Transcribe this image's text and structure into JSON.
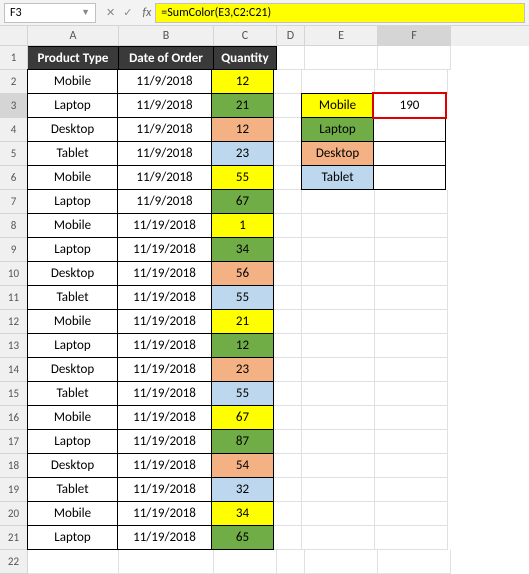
{
  "nameBox": "F3",
  "formula": "=SumColor(E3,C2:C21)",
  "colHeaders": [
    "A",
    "B",
    "C",
    "D",
    "E",
    "F"
  ],
  "selectedCol": "F",
  "selectedRow": "3",
  "tableHeaders": {
    "A": "Product Type",
    "B": "Date of Order",
    "C": "Quantity"
  },
  "rows": [
    {
      "n": "1"
    },
    {
      "n": "2",
      "A": "Mobile",
      "B": "11/9/2018",
      "C": "12",
      "cClass": "yellow"
    },
    {
      "n": "3",
      "A": "Laptop",
      "B": "11/9/2018",
      "C": "21",
      "cClass": "green",
      "E": "Mobile",
      "eClass": "yellow",
      "F": "190",
      "fActive": true
    },
    {
      "n": "4",
      "A": "Desktop",
      "B": "11/9/2018",
      "C": "12",
      "cClass": "peach",
      "E": "Laptop",
      "eClass": "green",
      "F": ""
    },
    {
      "n": "5",
      "A": "Tablet",
      "B": "11/9/2018",
      "C": "23",
      "cClass": "bluegray",
      "E": "Desktop",
      "eClass": "peach",
      "F": ""
    },
    {
      "n": "6",
      "A": "Mobile",
      "B": "11/9/2018",
      "C": "55",
      "cClass": "yellow",
      "E": "Tablet",
      "eClass": "bluegray",
      "F": ""
    },
    {
      "n": "7",
      "A": "Laptop",
      "B": "11/9/2018",
      "C": "67",
      "cClass": "green"
    },
    {
      "n": "8",
      "A": "Mobile",
      "B": "11/19/2018",
      "C": "1",
      "cClass": "yellow"
    },
    {
      "n": "9",
      "A": "Laptop",
      "B": "11/19/2018",
      "C": "34",
      "cClass": "green"
    },
    {
      "n": "10",
      "A": "Desktop",
      "B": "11/19/2018",
      "C": "56",
      "cClass": "peach"
    },
    {
      "n": "11",
      "A": "Tablet",
      "B": "11/19/2018",
      "C": "55",
      "cClass": "bluegray"
    },
    {
      "n": "12",
      "A": "Mobile",
      "B": "11/19/2018",
      "C": "21",
      "cClass": "yellow"
    },
    {
      "n": "13",
      "A": "Laptop",
      "B": "11/19/2018",
      "C": "12",
      "cClass": "green"
    },
    {
      "n": "14",
      "A": "Desktop",
      "B": "11/19/2018",
      "C": "23",
      "cClass": "peach"
    },
    {
      "n": "15",
      "A": "Tablet",
      "B": "11/19/2018",
      "C": "55",
      "cClass": "bluegray"
    },
    {
      "n": "16",
      "A": "Mobile",
      "B": "11/19/2018",
      "C": "67",
      "cClass": "yellow"
    },
    {
      "n": "17",
      "A": "Laptop",
      "B": "11/19/2018",
      "C": "87",
      "cClass": "green"
    },
    {
      "n": "18",
      "A": "Desktop",
      "B": "11/19/2018",
      "C": "54",
      "cClass": "peach"
    },
    {
      "n": "19",
      "A": "Tablet",
      "B": "11/19/2018",
      "C": "32",
      "cClass": "bluegray"
    },
    {
      "n": "20",
      "A": "Mobile",
      "B": "11/19/2018",
      "C": "34",
      "cClass": "yellow"
    },
    {
      "n": "21",
      "A": "Laptop",
      "B": "11/19/2018",
      "C": "65",
      "cClass": "green"
    },
    {
      "n": "22"
    }
  ]
}
